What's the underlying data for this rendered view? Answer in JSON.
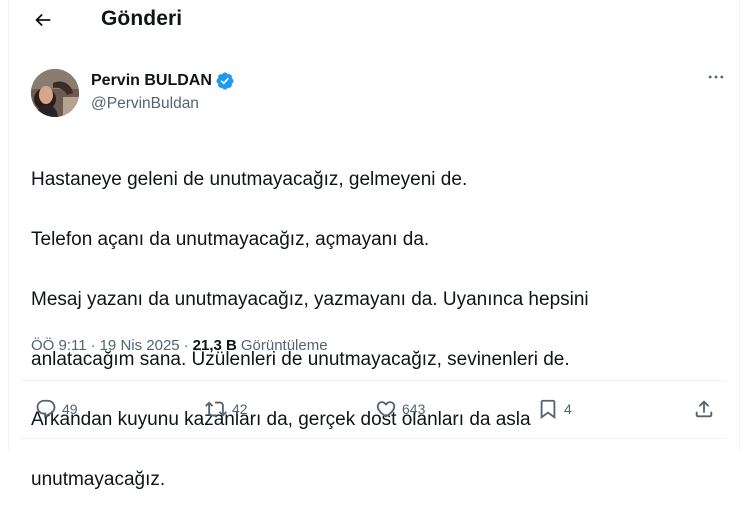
{
  "header": {
    "back_icon": "arrow-left-icon",
    "title": "Gönderi"
  },
  "author": {
    "name": "Pervin BULDAN",
    "handle": "@PervinBuldan",
    "verified_icon": "verified-badge-icon",
    "verified_color": "#1d9bf0"
  },
  "more_icon": "more-horizontal-icon",
  "tweet": {
    "lines": [
      "Hastaneye geleni de unutmayacağız, gelmeyeni de.",
      "Telefon açanı da unutmayacağız, açmayanı da.",
      "Mesaj yazanı da unutmayacağız, yazmayanı da. Uyanınca hepsini",
      "anlatacağım sana. Üzülenleri de unutmayacağız, sevinenleri de.",
      "Arkandan kuyunu kazanları da, gerçek dost olanları da asla",
      "unutmayacağız."
    ]
  },
  "meta": {
    "time": "ÖÖ 9:11",
    "separator": "·",
    "date": "19 Nis 2025",
    "views_count": "21,3 B",
    "views_label": "Görüntüleme"
  },
  "actions": {
    "reply": {
      "icon": "reply-icon",
      "count": "49"
    },
    "retweet": {
      "icon": "retweet-icon",
      "count": "42"
    },
    "like": {
      "icon": "heart-icon",
      "count": "643"
    },
    "bookmark": {
      "icon": "bookmark-icon",
      "count": "4"
    },
    "share": {
      "icon": "share-icon"
    }
  },
  "colors": {
    "text": "#0f1419",
    "secondary": "#536471",
    "divider": "#eff3f4",
    "accent": "#1d9bf0"
  }
}
